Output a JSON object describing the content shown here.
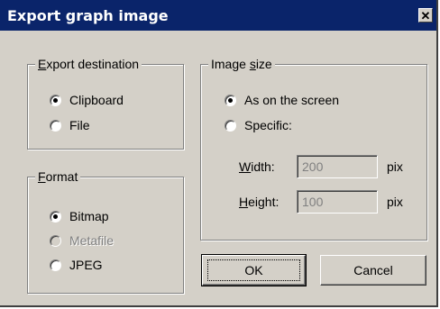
{
  "dialog": {
    "title": "Export graph image",
    "close_glyph": "✕"
  },
  "export_destination": {
    "legend_mnemonic": "E",
    "legend_rest": "xport destination",
    "options": [
      {
        "label": "Clipboard",
        "selected": true,
        "enabled": true
      },
      {
        "label": "File",
        "selected": false,
        "enabled": true
      }
    ]
  },
  "format": {
    "legend_mnemonic": "F",
    "legend_rest": "ormat",
    "options": [
      {
        "label": "Bitmap",
        "selected": true,
        "enabled": true
      },
      {
        "label": "Metafile",
        "selected": false,
        "enabled": false
      },
      {
        "label": "JPEG",
        "selected": false,
        "enabled": true
      }
    ]
  },
  "image_size": {
    "legend_before": "Image ",
    "legend_mnemonic": "s",
    "legend_after": "ize",
    "options": [
      {
        "label": "As on the screen",
        "selected": true,
        "enabled": true
      },
      {
        "label": "Specific:",
        "selected": false,
        "enabled": true
      }
    ],
    "width": {
      "label_mnemonic": "W",
      "label_rest": "idth:",
      "value": "200",
      "unit": "pix"
    },
    "height": {
      "label_mnemonic": "H",
      "label_rest": "eight:",
      "value": "100",
      "unit": "pix"
    }
  },
  "buttons": {
    "ok": "OK",
    "cancel": "Cancel"
  }
}
